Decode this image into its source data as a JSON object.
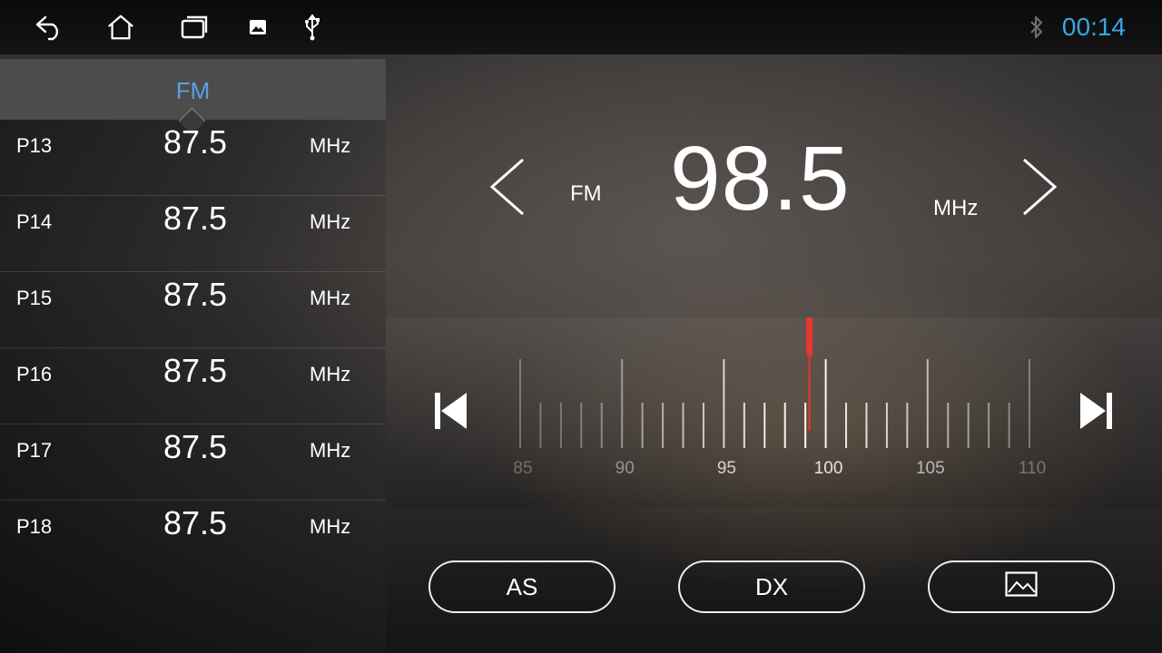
{
  "status_bar": {
    "icons": [
      "back-icon",
      "home-icon",
      "recent-apps-icon",
      "image-icon",
      "usb-icon",
      "bluetooth-icon"
    ],
    "clock": "00:14",
    "clock_color": "#3aa6e6"
  },
  "preset_panel": {
    "band_tab": "FM",
    "band_tab_color": "#5aa0e0",
    "presets": [
      {
        "name": "P13",
        "freq": "87.5",
        "unit": "MHz"
      },
      {
        "name": "P14",
        "freq": "87.5",
        "unit": "MHz"
      },
      {
        "name": "P15",
        "freq": "87.5",
        "unit": "MHz"
      },
      {
        "name": "P16",
        "freq": "87.5",
        "unit": "MHz"
      },
      {
        "name": "P17",
        "freq": "87.5",
        "unit": "MHz"
      },
      {
        "name": "P18",
        "freq": "87.5",
        "unit": "MHz"
      }
    ]
  },
  "tuner": {
    "band": "FM",
    "frequency": "98.5",
    "unit": "MHz",
    "prev_icon": "chevron-left-icon",
    "next_icon": "chevron-right-icon"
  },
  "dial": {
    "min": 85,
    "max": 110,
    "labels": [
      "85",
      "90",
      "95",
      "100",
      "105",
      "110"
    ],
    "needle_value": 99.2,
    "needle_color": "#e8372f",
    "seek_prev_icon": "skip-previous-icon",
    "seek_next_icon": "skip-next-icon"
  },
  "buttons": {
    "as_label": "AS",
    "dx_label": "DX",
    "wallpaper_icon": "image-icon"
  }
}
